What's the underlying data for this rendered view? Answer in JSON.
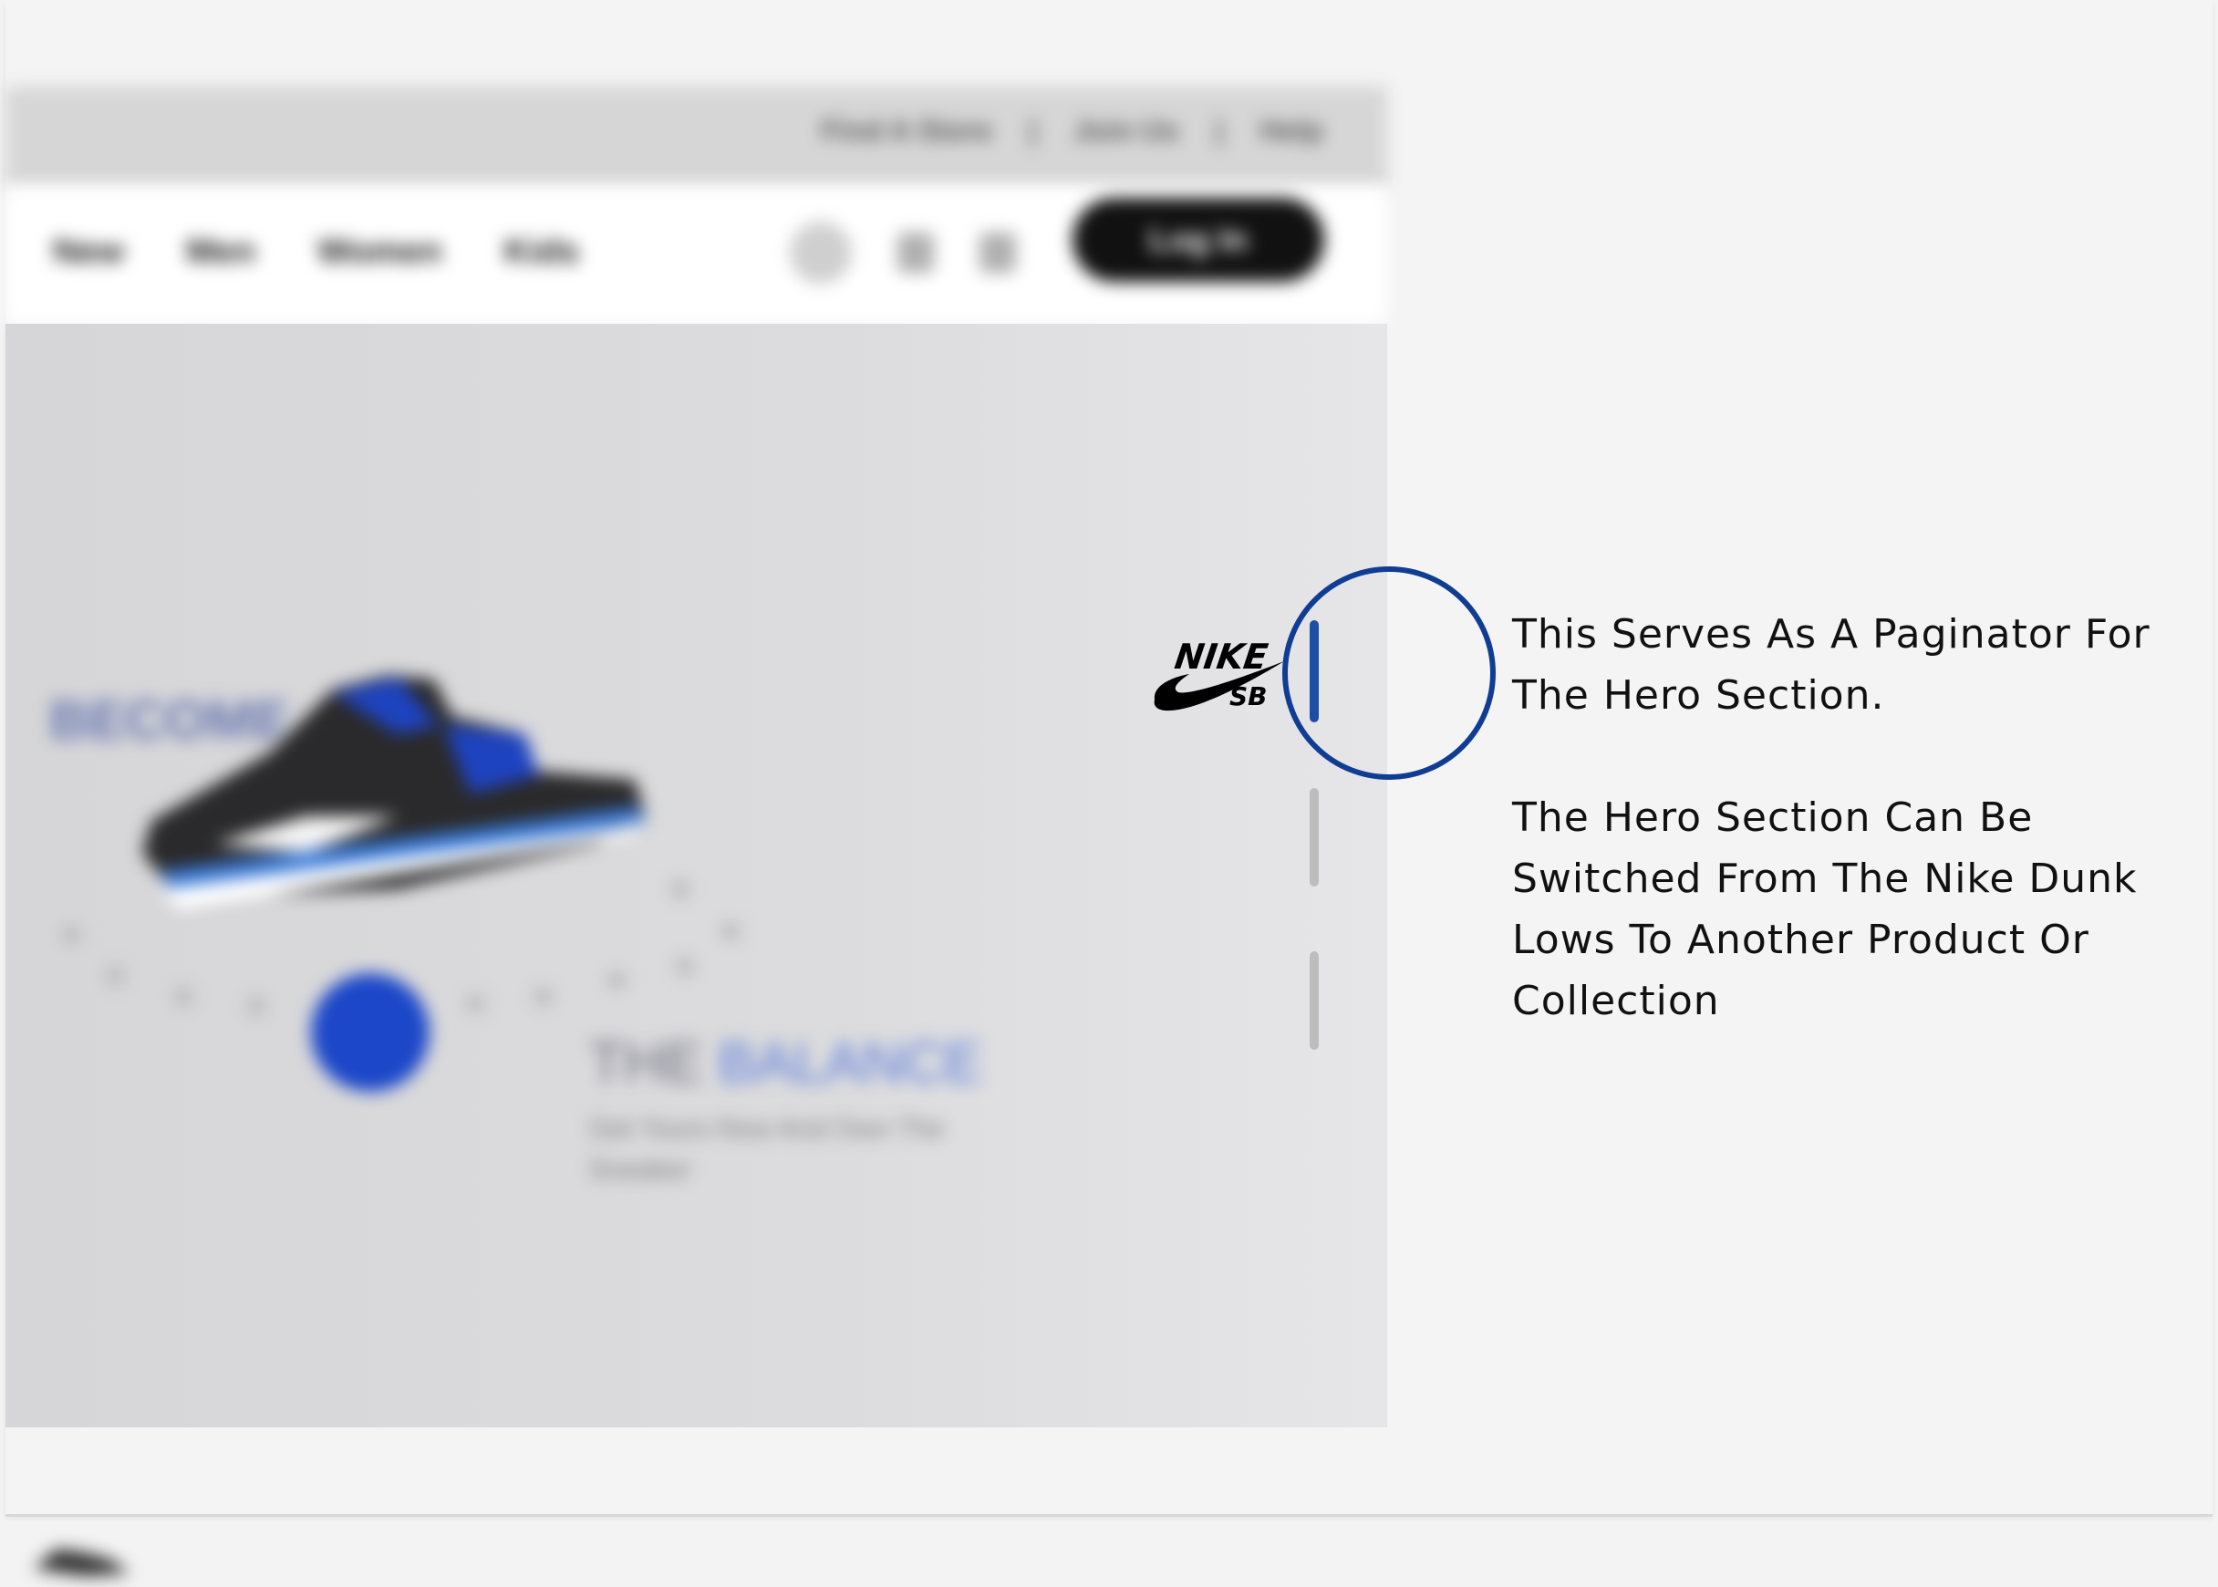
{
  "topbar": {
    "links": [
      "Find A Store",
      "Join Us",
      "Help"
    ],
    "separator": "|"
  },
  "nav": {
    "links": [
      "New",
      "Men",
      "Women",
      "Kids"
    ],
    "login_label": "Log In"
  },
  "hero": {
    "become": "BECOME",
    "balance_prefix": "THE ",
    "balance_accent": "BALANCE",
    "subtitle": "Get Yours Now And Own The Sneaker"
  },
  "logo": {
    "brand": "NIKE",
    "sub": "SB"
  },
  "paginator": {
    "pages": 3,
    "active_index": 0,
    "active_color": "#1e4ea3",
    "inactive_color": "#bdbdbd"
  },
  "annotation": {
    "line1": "This Serves As A Paginator For The Hero Section.",
    "line2": "The Hero Section Can Be Switched From The Nike Dunk Lows To Another Product Or Collection"
  },
  "colors": {
    "accent": "#0f3d94",
    "hero_blue": "#1b47c8"
  }
}
